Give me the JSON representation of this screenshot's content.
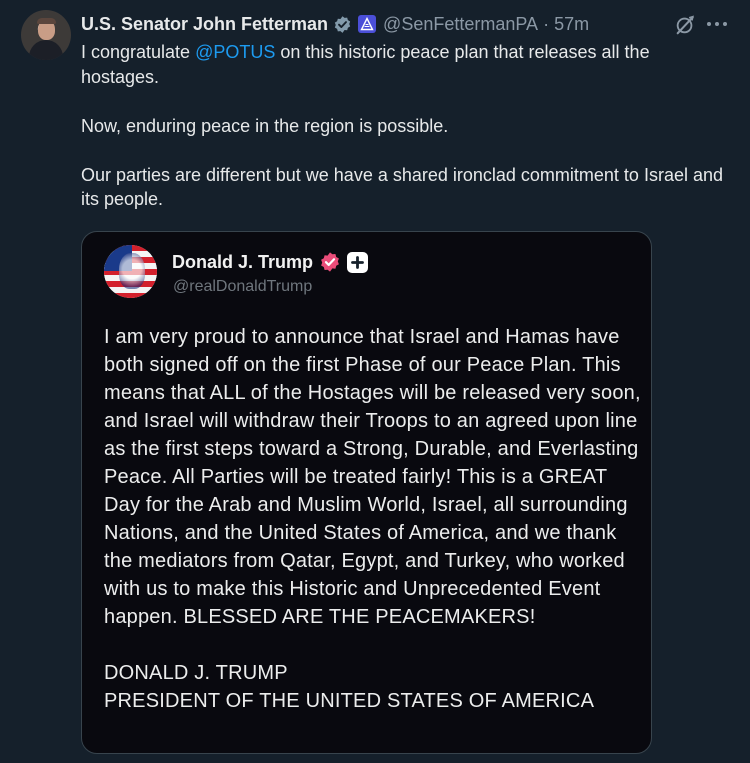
{
  "post": {
    "author_name": "U.S. Senator John Fetterman",
    "handle": "@SenFettermanPA",
    "separator": "·",
    "time": "57m",
    "text_before_mention": "I congratulate ",
    "mention": "@POTUS",
    "text_after_mention": " on this historic peace plan that releases all the hostages.\n\nNow, enduring peace in the region is possible.\n\nOur parties are different but we have a shared ironclad commitment to Israel and its people."
  },
  "quoted_post": {
    "author_name": "Donald J. Trump",
    "handle": "@realDonaldTrump",
    "text": "I am very proud to announce that Israel and Hamas have both signed off on the first Phase of our Peace Plan. This means that ALL of the Hostages will be released very soon, and Israel will withdraw their Troops to an agreed upon line as the first steps toward a Strong, Durable, and Everlasting Peace. All Parties will be treated fairly! This is a GREAT Day for the Arab and Muslim World, Israel, all surrounding Nations, and the United States of America, and we thank the mediators from Qatar, Egypt, and Turkey, who worked with us to make this Historic and Unprecedented Event happen. BLESSED ARE THE PEACEMAKERS!\n\nDONALD J. TRUMP\nPRESIDENT OF THE UNITED STATES OF AMERICA"
  },
  "icons": {
    "verified": "gray-verified-badge-icon",
    "affiliation": "us-senate-affiliation-icon",
    "grok": "grok-icon",
    "more": "more-options-icon",
    "quoted_verified": "truth-verified-badge-icon",
    "quoted_plus": "plus-icon"
  },
  "colors": {
    "background": "#15202b",
    "link": "#1d9bf0",
    "quote_background": "#09090f",
    "quote_badge": "#ea4c79"
  }
}
